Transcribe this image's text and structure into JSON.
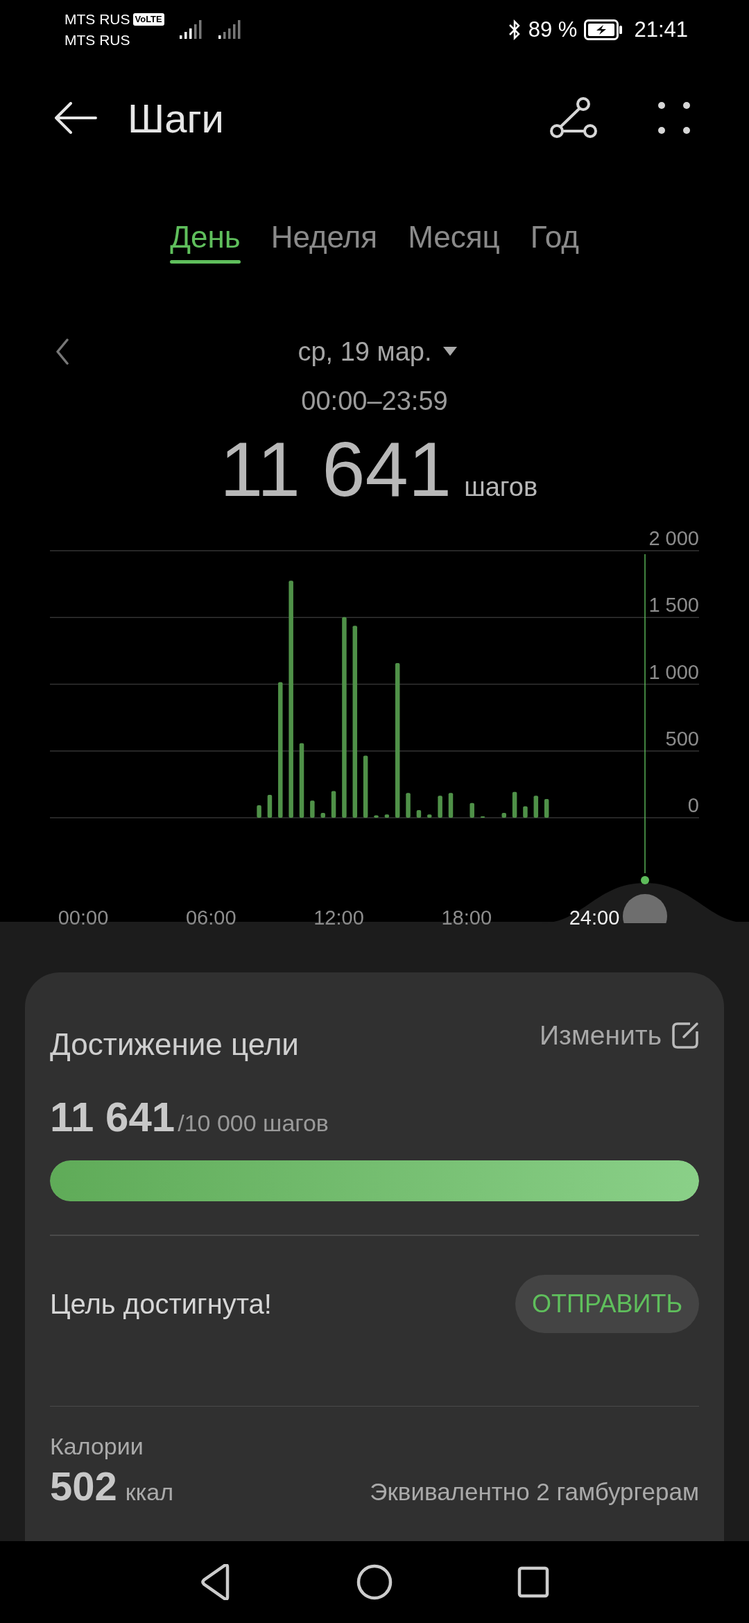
{
  "status_bar": {
    "carriers": [
      "MTS RUS",
      "MTS RUS"
    ],
    "volte": "VoLTE",
    "battery_text": "89 %",
    "time": "21:41"
  },
  "header": {
    "title": "Шаги"
  },
  "tabs": [
    {
      "label": "День",
      "selected": true
    },
    {
      "label": "Неделя",
      "selected": false
    },
    {
      "label": "Месяц",
      "selected": false
    },
    {
      "label": "Год",
      "selected": false
    }
  ],
  "date": "ср, 19 мар.",
  "range": "00:00–23:59",
  "total": {
    "value": "11 641",
    "unit": "шагов"
  },
  "chart": {
    "chart_data": {
      "type": "bar",
      "grid": true,
      "xlim": [
        0,
        24
      ],
      "ylim": [
        0,
        2000
      ],
      "x": [
        8,
        8.5,
        9,
        9.5,
        10,
        10.5,
        11,
        11.5,
        12,
        12.5,
        13,
        13.5,
        14,
        14.5,
        15,
        15.5,
        16,
        16.5,
        17,
        18,
        18.5,
        19.5,
        20,
        20.5,
        21,
        21.5
      ],
      "values": [
        93,
        172,
        1016,
        1775,
        558,
        129,
        36,
        200,
        1503,
        1438,
        465,
        18,
        25,
        1159,
        186,
        57,
        25,
        165,
        186,
        111,
        11,
        36,
        193,
        86,
        165,
        140
      ],
      "yticks": [
        {
          "value": 0,
          "label": "0"
        },
        {
          "value": 500,
          "label": "500"
        },
        {
          "value": 1000,
          "label": "1 000"
        },
        {
          "value": 1500,
          "label": "1 500"
        },
        {
          "value": 2000,
          "label": "2 000"
        }
      ],
      "xticks": [
        {
          "value": 0,
          "label": "00:00"
        },
        {
          "value": 6,
          "label": "06:00"
        },
        {
          "value": 12,
          "label": "12:00"
        },
        {
          "value": 18,
          "label": "18:00"
        },
        {
          "value": 24,
          "label": "24:00"
        }
      ]
    }
  },
  "goal": {
    "title": "Достижение цели",
    "edit_label": "Изменить",
    "current": "11 641",
    "target": "/10 000 шагов",
    "level": 1,
    "status": "Цель достигнута!",
    "share_button": "ОТПРАВИТЬ"
  },
  "calories": {
    "label": "Калории",
    "value": "502",
    "unit": "ккал",
    "note": "Эквивалентно 2 гамбургерам"
  }
}
